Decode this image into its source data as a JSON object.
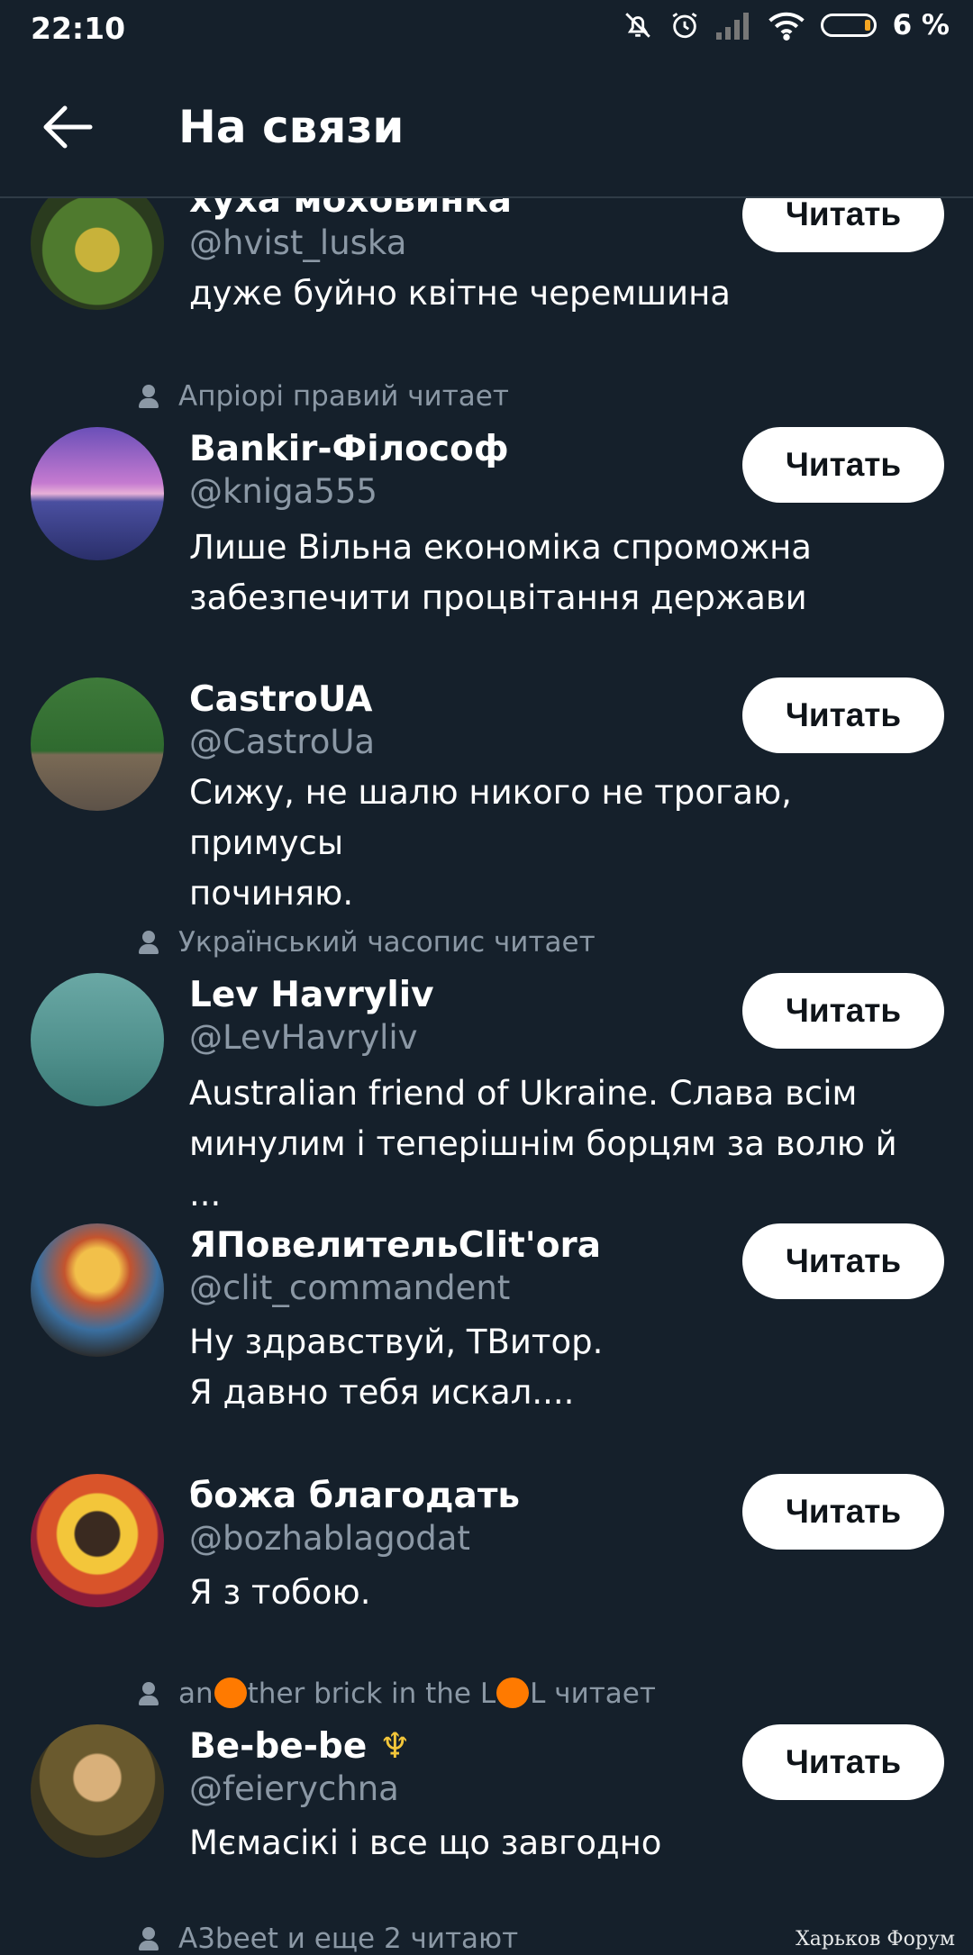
{
  "status_bar": {
    "time": "22:10",
    "battery_percent": "6 %"
  },
  "header": {
    "title": "На связи"
  },
  "follow_label": "Читать",
  "items": [
    {
      "context": "",
      "name": "хуха моховинка",
      "handle": "@hvist_luska",
      "bio_lines": [
        "дуже буйно квітне черемшина"
      ]
    },
    {
      "context": "Апріорі правий читает",
      "name": "Bankir-Філософ",
      "handle": "@kniga555",
      "bio_lines": [
        "Лише Вільна економіка спроможна",
        "забезпечити процвітання держави"
      ]
    },
    {
      "context": "",
      "name": "CastroUA",
      "handle": "@CastroUa",
      "bio_lines": [
        "Сижу, не шалю никого не трогаю, примусы",
        "починяю."
      ]
    },
    {
      "context": "Український часопис читает",
      "name": "Lev Havryliv",
      "handle": "@LevHavryliv",
      "bio_lines": [
        "Australian friend of Ukraine. Слава всім",
        "минулим і теперішнім борцям за волю й ..."
      ]
    },
    {
      "context": "",
      "name": "ЯПовелительClit'ora",
      "handle": "@clit_commandent",
      "bio_lines": [
        "Ну здравствуй, ТВитор.",
        "Я давно тебя искал...."
      ]
    },
    {
      "context": "",
      "name": "божа благодать",
      "handle": "@bozhablagodat",
      "bio_lines": [
        "Я з тобою."
      ]
    },
    {
      "context_parts": [
        "an",
        "ther brick in the L",
        "L читает"
      ],
      "name": "Be-be-be",
      "handle": "@feierychna",
      "bio_lines": [
        "Мємасікі і все що завгодно"
      ]
    },
    {
      "context": "A3beet и еще 2 читают"
    }
  ],
  "watermark": "Харьков Форум",
  "colors": {
    "background": "#15202b",
    "secondary_text": "#8b98a5",
    "button_bg": "#ffffff",
    "button_text": "#0f1419"
  }
}
